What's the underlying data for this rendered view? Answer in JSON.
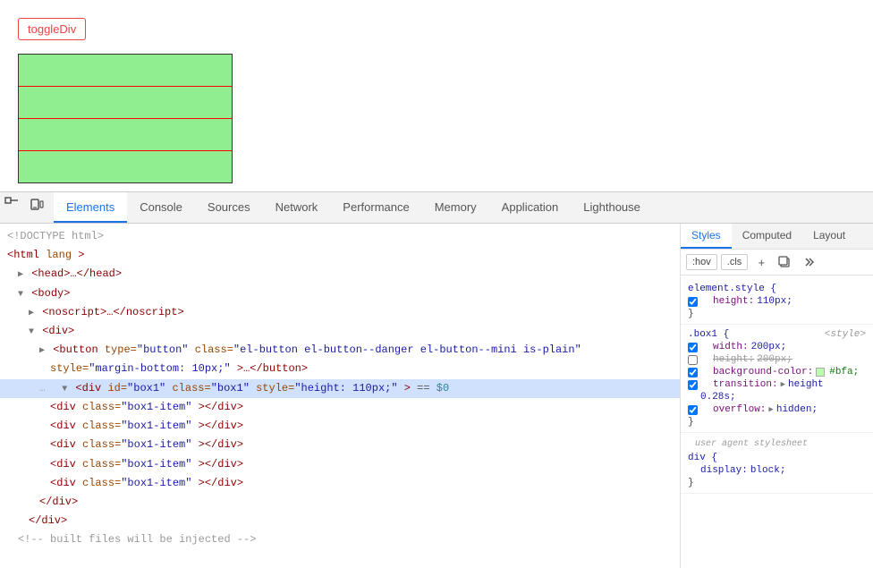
{
  "preview": {
    "toggle_btn_label": "toggleDiv"
  },
  "devtools": {
    "toolbar": {
      "inspect_icon": "⊹",
      "device_icon": "▭"
    },
    "tabs": [
      {
        "id": "elements",
        "label": "Elements",
        "active": true
      },
      {
        "id": "console",
        "label": "Console",
        "active": false
      },
      {
        "id": "sources",
        "label": "Sources",
        "active": false
      },
      {
        "id": "network",
        "label": "Network",
        "active": false
      },
      {
        "id": "performance",
        "label": "Performance",
        "active": false
      },
      {
        "id": "memory",
        "label": "Memory",
        "active": false
      },
      {
        "id": "application",
        "label": "Application",
        "active": false
      },
      {
        "id": "lighthouse",
        "label": "Lighthouse",
        "active": false
      }
    ],
    "elements": {
      "lines": [
        {
          "indent": 1,
          "html": "<!DOCTYPE html>",
          "type": "comment"
        },
        {
          "indent": 1,
          "html": "<html lang>",
          "type": "tag"
        },
        {
          "indent": 2,
          "html": "▶ <head>…</head>",
          "type": "tag"
        },
        {
          "indent": 2,
          "html": "▼ <body>",
          "type": "tag"
        },
        {
          "indent": 3,
          "html": "▶ <noscript>…</noscript>",
          "type": "tag"
        },
        {
          "indent": 3,
          "html": "▼ <div>",
          "type": "tag"
        },
        {
          "indent": 4,
          "html": "▶ <button type=\"button\" class=\"el-button el-button--danger el-button--mini is-plain\"",
          "type": "tag"
        },
        {
          "indent": 5,
          "html": "style=\"margin-bottom: 10px;\">…</button>",
          "type": "tag"
        },
        {
          "indent": 4,
          "html": "▼ <div id=\"box1\" class=\"box1\" style=\"height: 110px;\"> == $0",
          "type": "selected"
        },
        {
          "indent": 5,
          "html": "<div class=\"box1-item\"></div>",
          "type": "tag"
        },
        {
          "indent": 5,
          "html": "<div class=\"box1-item\"></div>",
          "type": "tag"
        },
        {
          "indent": 5,
          "html": "<div class=\"box1-item\"></div>",
          "type": "tag"
        },
        {
          "indent": 5,
          "html": "<div class=\"box1-item\"></div>",
          "type": "tag"
        },
        {
          "indent": 5,
          "html": "<div class=\"box1-item\"></div>",
          "type": "tag"
        },
        {
          "indent": 4,
          "html": "</div>",
          "type": "tag"
        },
        {
          "indent": 3,
          "html": "</div>",
          "type": "tag"
        },
        {
          "indent": 2,
          "html": "<!-- built files will be injected -->",
          "type": "comment"
        }
      ]
    }
  },
  "styles": {
    "tabs": [
      {
        "label": "Styles",
        "active": true
      },
      {
        "label": "Computed",
        "active": false
      },
      {
        "label": "Layout",
        "active": false
      }
    ],
    "toolbar": {
      "hov_label": ":hov",
      "cls_label": ".cls",
      "plus_icon": "+",
      "copy_icon": "⧉",
      "more_icon": "≫"
    },
    "rules": [
      {
        "selector": "element.style {",
        "source": "",
        "props": [
          {
            "name": "height:",
            "value": "110px;",
            "checked": true,
            "strikethrough": false
          }
        ],
        "close": "}"
      },
      {
        "selector": ".box1 {",
        "source": "<style>",
        "props": [
          {
            "name": "width:",
            "value": "200px;",
            "checked": true,
            "strikethrough": false
          },
          {
            "name": "height:",
            "value": "200px;",
            "checked": false,
            "strikethrough": true
          },
          {
            "name": "background-color:",
            "value": "#bfa;",
            "checked": true,
            "strikethrough": false,
            "swatch": "#bbffaa"
          },
          {
            "name": "transition:",
            "value": "▶ height 0.28s;",
            "checked": true,
            "strikethrough": false
          },
          {
            "name": "overflow:",
            "value": "▶ hidden;",
            "checked": true,
            "strikethrough": false
          }
        ],
        "close": "}"
      },
      {
        "ua_label": "user agent stylesheet",
        "selector": "div {",
        "props": [
          {
            "name": "display:",
            "value": "block;",
            "checked": true,
            "strikethrough": false
          }
        ],
        "close": "}"
      }
    ]
  }
}
